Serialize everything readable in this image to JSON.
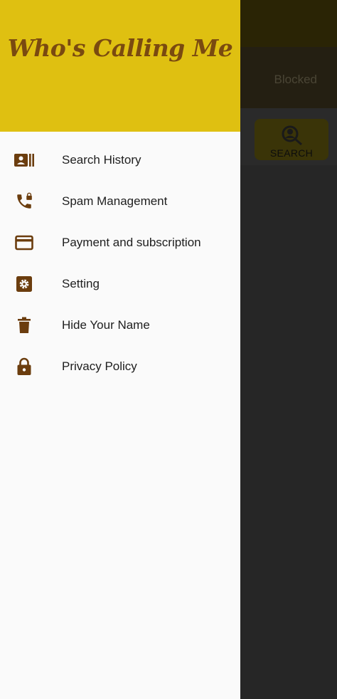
{
  "app": {
    "title": "Who's Calling Me"
  },
  "background": {
    "tab_blocked": "Blocked",
    "search_button_label": "SEARCH"
  },
  "drawer": {
    "items": [
      {
        "label": "Search History",
        "icon": "contact-card-icon"
      },
      {
        "label": "Spam Management",
        "icon": "phone-lock-icon"
      },
      {
        "label": "Payment and subscription",
        "icon": "credit-card-icon"
      },
      {
        "label": "Setting",
        "icon": "settings-gear-icon"
      },
      {
        "label": "Hide Your Name",
        "icon": "trash-icon"
      },
      {
        "label": "Privacy Policy",
        "icon": "lock-icon"
      }
    ]
  },
  "colors": {
    "header": "#dfc011",
    "icon": "#6b3d0e",
    "title": "#7a4a10",
    "scrim": "#262626"
  }
}
